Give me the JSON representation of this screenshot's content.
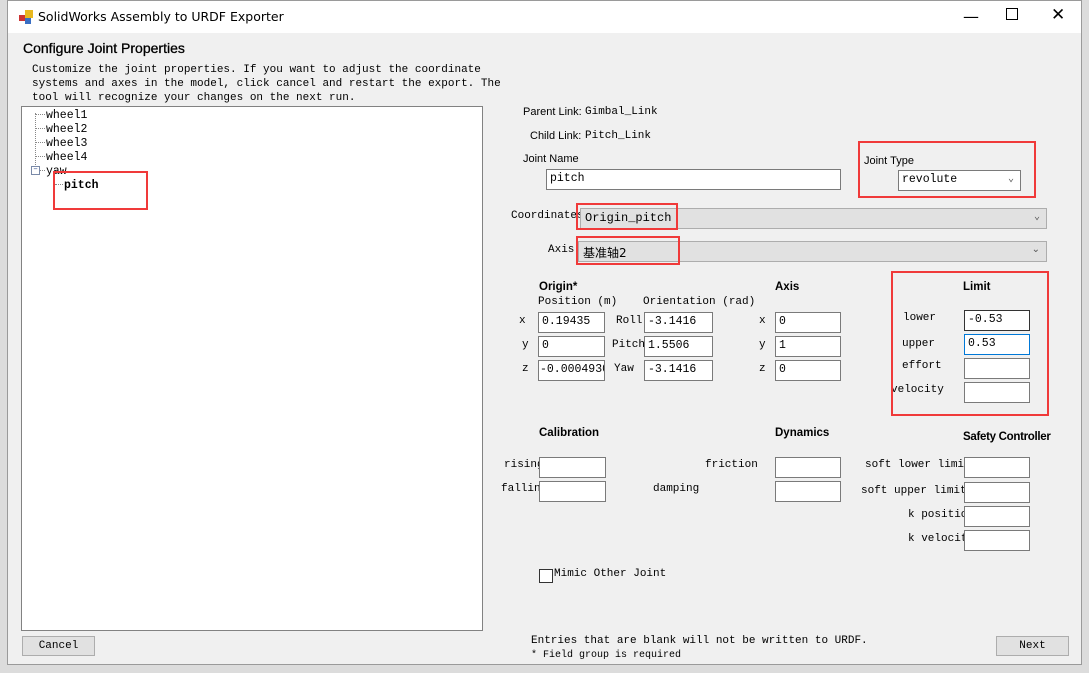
{
  "window": {
    "title": "SolidWorks Assembly to URDF Exporter",
    "controls": [
      "minimize",
      "maximize",
      "close"
    ]
  },
  "header": {
    "title": "Configure Joint Properties",
    "description": [
      "Customize the joint properties. If you want to adjust the coordinate",
      "systems and axes in the model, click cancel and restart the export. The",
      "tool will recognize your changes on the next run."
    ]
  },
  "tree": {
    "items": [
      {
        "label": "wheel1"
      },
      {
        "label": "wheel2"
      },
      {
        "label": "wheel3"
      },
      {
        "label": "wheel4"
      },
      {
        "label": "yaw",
        "expanded": true
      },
      {
        "label": "pitch",
        "selected": true
      }
    ]
  },
  "links": {
    "parent_label": "Parent Link:",
    "parent_value": "Gimbal_Link",
    "child_label": "Child Link:",
    "child_value": "Pitch_Link"
  },
  "joint": {
    "name_label": "Joint Name",
    "name_value": "pitch",
    "type_label": "Joint Type",
    "type_value": "revolute"
  },
  "coordinates": {
    "label": "Coordinates",
    "value": "Origin_pitch"
  },
  "axis_select": {
    "label": "Axis",
    "value": "基准轴2"
  },
  "origin": {
    "title": "Origin*",
    "position_label": "Position (m)",
    "orientation_label": "Orientation (rad)",
    "x_label": "x",
    "y_label": "y",
    "z_label": "z",
    "x": "0.19435",
    "y": "0",
    "z": "-0.0004930",
    "roll_label": "Roll",
    "pitch_label": "Pitch",
    "yaw_label": "Yaw",
    "roll": "-3.1416",
    "pitch": "1.5506",
    "yaw": "-3.1416"
  },
  "axis": {
    "title": "Axis",
    "x_label": "x",
    "y_label": "y",
    "z_label": "z",
    "x": "0",
    "y": "1",
    "z": "0"
  },
  "limit": {
    "title": "Limit",
    "lower_label": "lower",
    "upper_label": "upper",
    "effort_label": "effort",
    "velocity_label": "velocity",
    "lower": "-0.53",
    "upper": "0.53",
    "effort": "",
    "velocity": ""
  },
  "calibration": {
    "title": "Calibration",
    "rising_label": "rising",
    "falling_label": "falling",
    "rising": "",
    "falling": ""
  },
  "dynamics": {
    "title": "Dynamics",
    "friction_label": "friction",
    "damping_label": "damping",
    "friction": "",
    "damping": ""
  },
  "safety": {
    "title": "Safety Controller",
    "soft_lower_label": "soft lower limit",
    "soft_upper_label": "soft upper limit",
    "k_position_label": "k position",
    "k_velocity_label": "k velocity",
    "soft_lower": "",
    "soft_upper": "",
    "k_position": "",
    "k_velocity": ""
  },
  "mimic": {
    "label": "Mimic Other Joint",
    "checked": false
  },
  "footer": {
    "note1": "Entries that are blank will not be written to URDF.",
    "note2": "* Field group is required",
    "cancel": "Cancel",
    "next": "Next"
  },
  "colors": {
    "annotation": "#f03a3a",
    "focus_border": "#0078d7"
  }
}
